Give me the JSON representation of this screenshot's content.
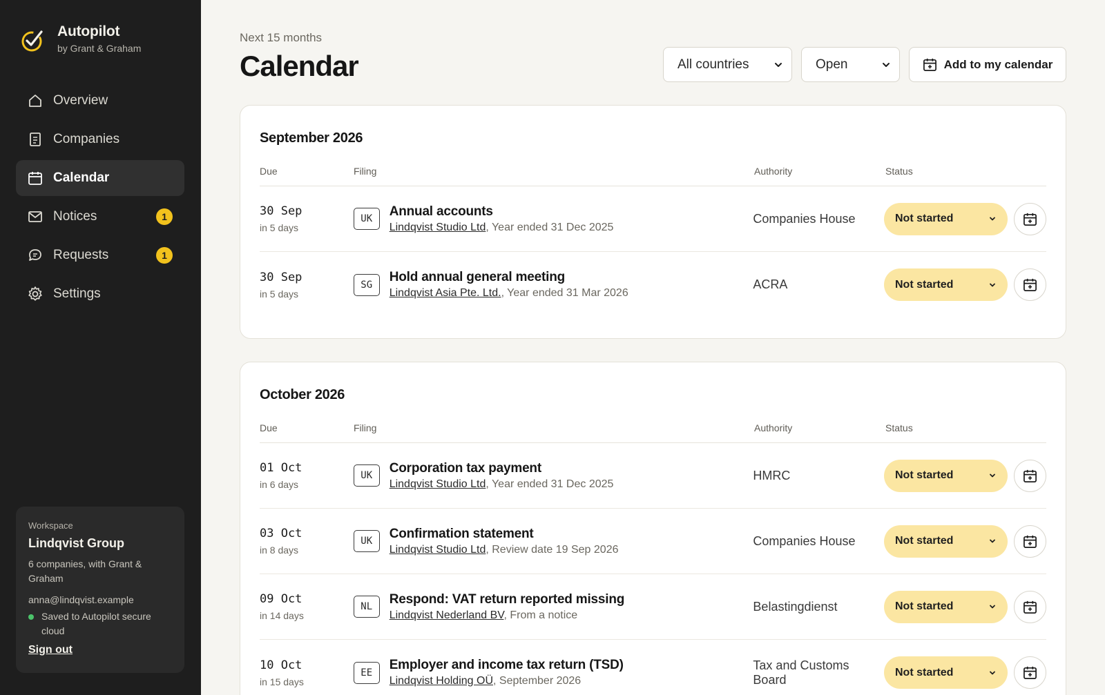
{
  "brand": {
    "name": "Autopilot",
    "sub": "by Grant & Graham",
    "accent": "#f2c21d"
  },
  "nav": [
    {
      "label": "Overview",
      "icon": "home-icon"
    },
    {
      "label": "Companies",
      "icon": "document-icon"
    },
    {
      "label": "Calendar",
      "icon": "calendar-icon",
      "active": true
    },
    {
      "label": "Notices",
      "icon": "mail-icon",
      "badge": "1"
    },
    {
      "label": "Requests",
      "icon": "chat-icon",
      "badge": "1"
    },
    {
      "label": "Settings",
      "icon": "gear-icon"
    }
  ],
  "workspace": {
    "label": "Workspace",
    "name": "Lindqvist Group",
    "desc": "6 companies, with Grant & Graham",
    "email": "anna@lindqvist.example",
    "saved": "Saved to Autopilot secure cloud",
    "signout": "Sign out"
  },
  "header": {
    "eyebrow": "Next 15 months",
    "title": "Calendar",
    "country_select": "All countries",
    "status_select": "Open",
    "add_button": "Add to my calendar"
  },
  "columns": {
    "due": "Due",
    "filing": "Filing",
    "authority": "Authority",
    "status": "Status"
  },
  "months": [
    {
      "title": "September 2026",
      "rows": [
        {
          "date": "30 Sep",
          "rel": "in 5 days",
          "cc": "UK",
          "title": "Annual accounts",
          "company": "Lindqvist Studio Ltd",
          "detail": ", Year ended 31 Dec 2025",
          "authority": "Companies House",
          "status": "Not started"
        },
        {
          "date": "30 Sep",
          "rel": "in 5 days",
          "cc": "SG",
          "title": "Hold annual general meeting",
          "company": "Lindqvist Asia Pte. Ltd.",
          "detail": ", Year ended 31 Mar 2026",
          "authority": "ACRA",
          "status": "Not started"
        }
      ]
    },
    {
      "title": "October 2026",
      "rows": [
        {
          "date": "01 Oct",
          "rel": "in 6 days",
          "cc": "UK",
          "title": "Corporation tax payment",
          "company": "Lindqvist Studio Ltd",
          "detail": ", Year ended 31 Dec 2025",
          "authority": "HMRC",
          "status": "Not started"
        },
        {
          "date": "03 Oct",
          "rel": "in 8 days",
          "cc": "UK",
          "title": "Confirmation statement",
          "company": "Lindqvist Studio Ltd",
          "detail": ", Review date 19 Sep 2026",
          "authority": "Companies House",
          "status": "Not started"
        },
        {
          "date": "09 Oct",
          "rel": "in 14 days",
          "cc": "NL",
          "title": "Respond: VAT return reported missing",
          "company": "Lindqvist Nederland BV",
          "detail": ", From a notice",
          "authority": "Belastingdienst",
          "status": "Not started"
        },
        {
          "date": "10 Oct",
          "rel": "in 15 days",
          "cc": "EE",
          "title": "Employer and income tax return (TSD)",
          "company": "Lindqvist Holding OÜ",
          "detail": ", September 2026",
          "authority": "Tax and Customs Board",
          "status": "Not started"
        }
      ]
    }
  ]
}
